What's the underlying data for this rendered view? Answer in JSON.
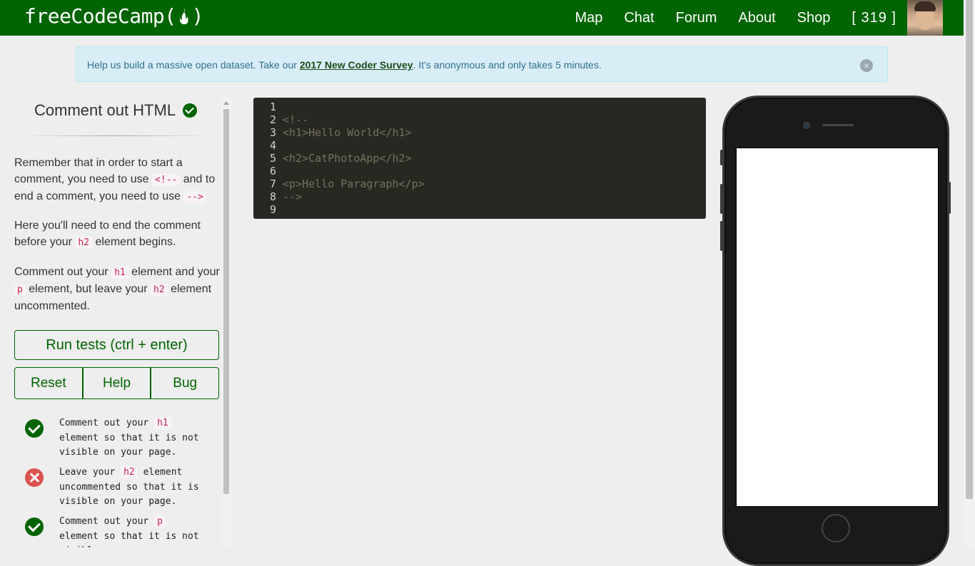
{
  "navbar": {
    "brand_left": "freeCodeCamp(",
    "brand_right": ")",
    "links": [
      "Map",
      "Chat",
      "Forum",
      "About",
      "Shop"
    ],
    "points": "[ 319 ]"
  },
  "alert": {
    "text_before": "Help us build a massive open dataset. Take our ",
    "link": "2017 New Coder Survey",
    "text_after": ". It's anonymous and only takes 5 minutes.",
    "close": "×"
  },
  "challenge": {
    "title": "Comment out HTML",
    "p1_a": "Remember that in order to start a comment, you need to use ",
    "p1_code1": "<!--",
    "p1_b": " and to end a comment, you need to use ",
    "p1_code2": "-->",
    "p2_a": "Here you'll need to end the comment before your ",
    "p2_code": "h2",
    "p2_b": " element begins.",
    "p3_a": "Comment out your ",
    "p3_code1": "h1",
    "p3_b": " element and your ",
    "p3_code2": "p",
    "p3_c": " element, but leave your ",
    "p3_code3": "h2",
    "p3_d": " element uncommented."
  },
  "buttons": {
    "run": "Run tests (ctrl + enter)",
    "reset": "Reset",
    "help": "Help",
    "bug": "Bug"
  },
  "tests": [
    {
      "status": "pass",
      "a": "Comment out your ",
      "code": "h1",
      "b": " element so that it is not visible on your page."
    },
    {
      "status": "fail",
      "a": "Leave your ",
      "code": "h2",
      "b": " element uncommented so that it is visible on your page."
    },
    {
      "status": "pass",
      "a": "Comment out your ",
      "code": "p",
      "b": " element so that it is not visible"
    }
  ],
  "editor": {
    "lines": [
      {
        "n": "1",
        "code": ""
      },
      {
        "n": "2",
        "code": "<!--"
      },
      {
        "n": "3",
        "code": "<h1>Hello World</h1>"
      },
      {
        "n": "4",
        "code": ""
      },
      {
        "n": "5",
        "code": "<h2>CatPhotoApp</h2>"
      },
      {
        "n": "6",
        "code": ""
      },
      {
        "n": "7",
        "code": "<p>Hello Paragraph</p>"
      },
      {
        "n": "8",
        "code": "-->"
      },
      {
        "n": "9",
        "code": ""
      }
    ]
  },
  "colors": {
    "brand_green": "#006400",
    "alert_bg": "#d9edf7",
    "editor_bg": "#272822",
    "fail_red": "#d9534f"
  }
}
